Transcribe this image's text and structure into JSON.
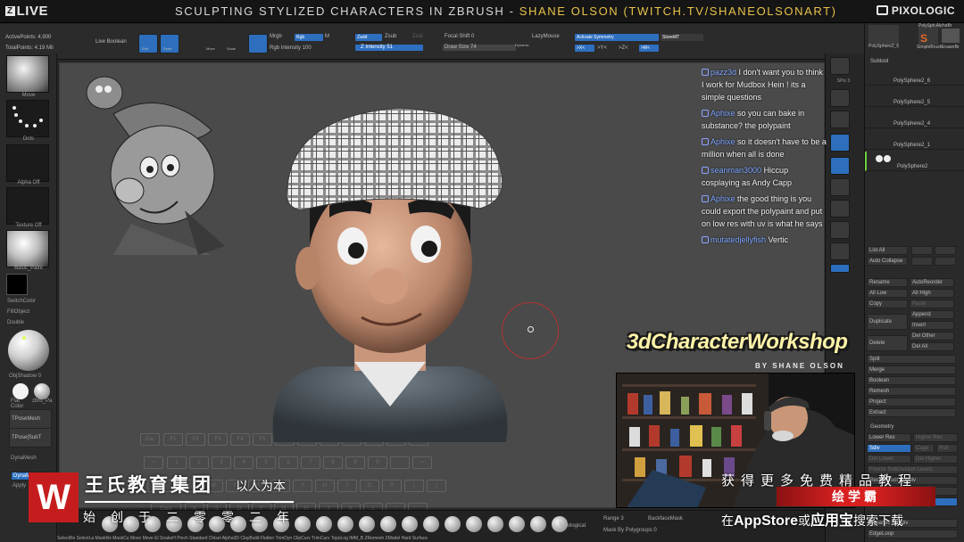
{
  "banner": {
    "logo_text": "LIVE",
    "title_main": "SCULPTING STYLIZED CHARACTERS IN ZBRUSH - ",
    "title_highlight": "SHANE OLSON (TWITCH.TV/SHANEOLSONART)",
    "brand": "PIXOLOGIC"
  },
  "toolbar": {
    "active_points": "ActivePoints: 4,900",
    "total_points": "TotalPoints: 4.19 Mil",
    "live_boolean": "Live Boolean",
    "mrgb": "Mrgb",
    "rgb": "Rgb",
    "m": "M",
    "zadd": "Zadd",
    "zsub": "Zsub",
    "zcut": "Zcut",
    "rgb_intensity": "Rgb Intensity 100",
    "z_intensity": "Z Intensity 51",
    "focal_shift": "Focal Shift 0",
    "draw_size": "Draw Size 74",
    "dynamic": "Dynamic",
    "lazymouse": "LazyMouse",
    "activate_symmetry": "Activate Symmetry",
    "storemt": "StoreMT",
    "x_axis": ">X<",
    "y_axis": ">Y<",
    "z_axis": ">Z<",
    "m_axis": ">M<",
    "edit_buttons": [
      "Edit",
      "Draw",
      "Move",
      "Scale",
      "Rotate"
    ]
  },
  "left_shelf": {
    "brush_label": "Move",
    "stroke_label": "Dots",
    "alpha_label": "Alpha Off",
    "texture_label": "Texture Off",
    "material_label": "Basic_Paint",
    "switch_color": "SwitchColor",
    "fill_object": "FillObject",
    "double": "Double",
    "obj_shadow": "ObjShadow 0",
    "flat_color": "Flat Color",
    "zbro_mat": "zbro_Pa",
    "tposemesh": "TPoseMesh",
    "tpose_subt": "TPose|SubT",
    "dynamesh": "DynaMesh",
    "dynamesh2": "DynaM",
    "apply": "Apply"
  },
  "mid_right": {
    "labels": [
      "SPix 3",
      "Dynamic",
      "Persp",
      "Floor",
      "Local",
      "Frame",
      "Line Fill",
      "PolyF",
      "Move",
      "Scale",
      "Rotate",
      "Transp",
      "Ghost",
      "Solo",
      "Xpose",
      "Qrp"
    ],
    "spix": "SPix 3"
  },
  "subtool": {
    "tabs": [
      "PolySphere2_6",
      "PolySph AlphaBr",
      "SimpleBrush",
      "EraserBr"
    ],
    "title": "Subtool",
    "items": [
      "PolySphere2_6",
      "PolySphere2_5",
      "PolySphere2_4",
      "PolySphere2_1",
      "PolySphere2"
    ],
    "buttons": [
      [
        "List All",
        "",
        ""
      ],
      [
        "Auto Collapse",
        "",
        ""
      ],
      [
        "Rename",
        "AutoReorder"
      ],
      [
        "All Low",
        "All High"
      ],
      [
        "Copy",
        "Paste"
      ],
      [
        "Duplicate",
        "Append"
      ],
      [
        "",
        "Insert"
      ],
      [
        "Delete",
        "Del Other"
      ],
      [
        "",
        "Del All"
      ],
      [
        "Split",
        ""
      ],
      [
        "Merge",
        ""
      ],
      [
        "Boolean",
        ""
      ],
      [
        "Remesh",
        ""
      ],
      [
        "Project",
        ""
      ],
      [
        "Extract",
        ""
      ]
    ],
    "geometry_title": "Geometry",
    "geometry_items": [
      "Lower Res",
      "Higher Res",
      "Sdiv",
      "Cage",
      "Rstr",
      "Del Lower",
      "Del Higher",
      "Freeze SubDivision Levels",
      "Reconstruct Subdiv",
      "Convert BPR To Geo",
      "Divide",
      "Dynamic Subdiv",
      "EdgeLoop"
    ]
  },
  "chat": [
    {
      "user": "pazz3d",
      "text": "I don't want you to think I work for Mudbox Hein ! its a simple questions"
    },
    {
      "user": "Aphixe",
      "text": "so you can bake in substance? the polypaint"
    },
    {
      "user": "Aphixe",
      "text": "so it doesn't have to be a million when all is done"
    },
    {
      "user": "seanman3000",
      "text": "Hiccup cosplaying as Andy Capp"
    },
    {
      "user": "Aphixe",
      "text": "the good thing is you could export the polypaint and put on low res with uv is what he says"
    },
    {
      "user": "mutatedjellyfish",
      "text": "Vertic"
    }
  ],
  "workshop": {
    "title": "3dCharacterWorkshop",
    "byline": "BY SHANE OLSON"
  },
  "keyboard": {
    "row0": [
      "Esc",
      "F1",
      "F2",
      "F3",
      "F4",
      "F5",
      "F6",
      "F7",
      "F8",
      "F9",
      "F10",
      "F11",
      "F12"
    ],
    "row1": [
      "~",
      "1",
      "2",
      "3",
      "4",
      "5",
      "6",
      "7",
      "8",
      "9",
      "0",
      "-",
      "="
    ],
    "row2": [
      "Tab",
      "Q",
      "W",
      "E",
      "R",
      "T",
      "Y",
      "U",
      "I",
      "O",
      "P",
      "[",
      "]"
    ],
    "row3": [
      "Caps",
      "A",
      "S",
      "D",
      "F",
      "G",
      "H",
      "J",
      "K",
      "L",
      ";",
      "'"
    ],
    "row4": [
      "Shift",
      "Z",
      "X",
      "C",
      "V",
      "B",
      "N",
      "M",
      ",",
      ".",
      "/"
    ]
  },
  "bottom": {
    "brushes": "SelectRe SelectLa MaskRe MaskCu Move Move El SnakeH Pinch Standard Chisel Alpha3D ClayBuild Flatten TrimDyn ClipCurv TrimCurv TopoLog IMM_B ZRemesh ZModel Hard Surface",
    "topological": "Topological",
    "range": "Range 3",
    "backface_mask": "BackfaceMask",
    "mask_polygroups": "Mask By Polygroups 0"
  },
  "watermark": {
    "logo_char": "W",
    "company": "王氏教育集团",
    "slogan": "以人为本",
    "since": "始创于二零零二年",
    "promo": "获得更多免费精品教程",
    "xueba": "绘学霸",
    "store_prefix": "在",
    "store_appstore": "AppStore",
    "store_or": "或",
    "store_yyb": "应用宝",
    "store_suffix": "搜索下载"
  },
  "colors": {
    "twitch_yellow": "#e9c24a",
    "zbrush_blue": "#2d6fbd",
    "chat_user": "#7da6ff",
    "watermark_red": "#c51d1d"
  }
}
